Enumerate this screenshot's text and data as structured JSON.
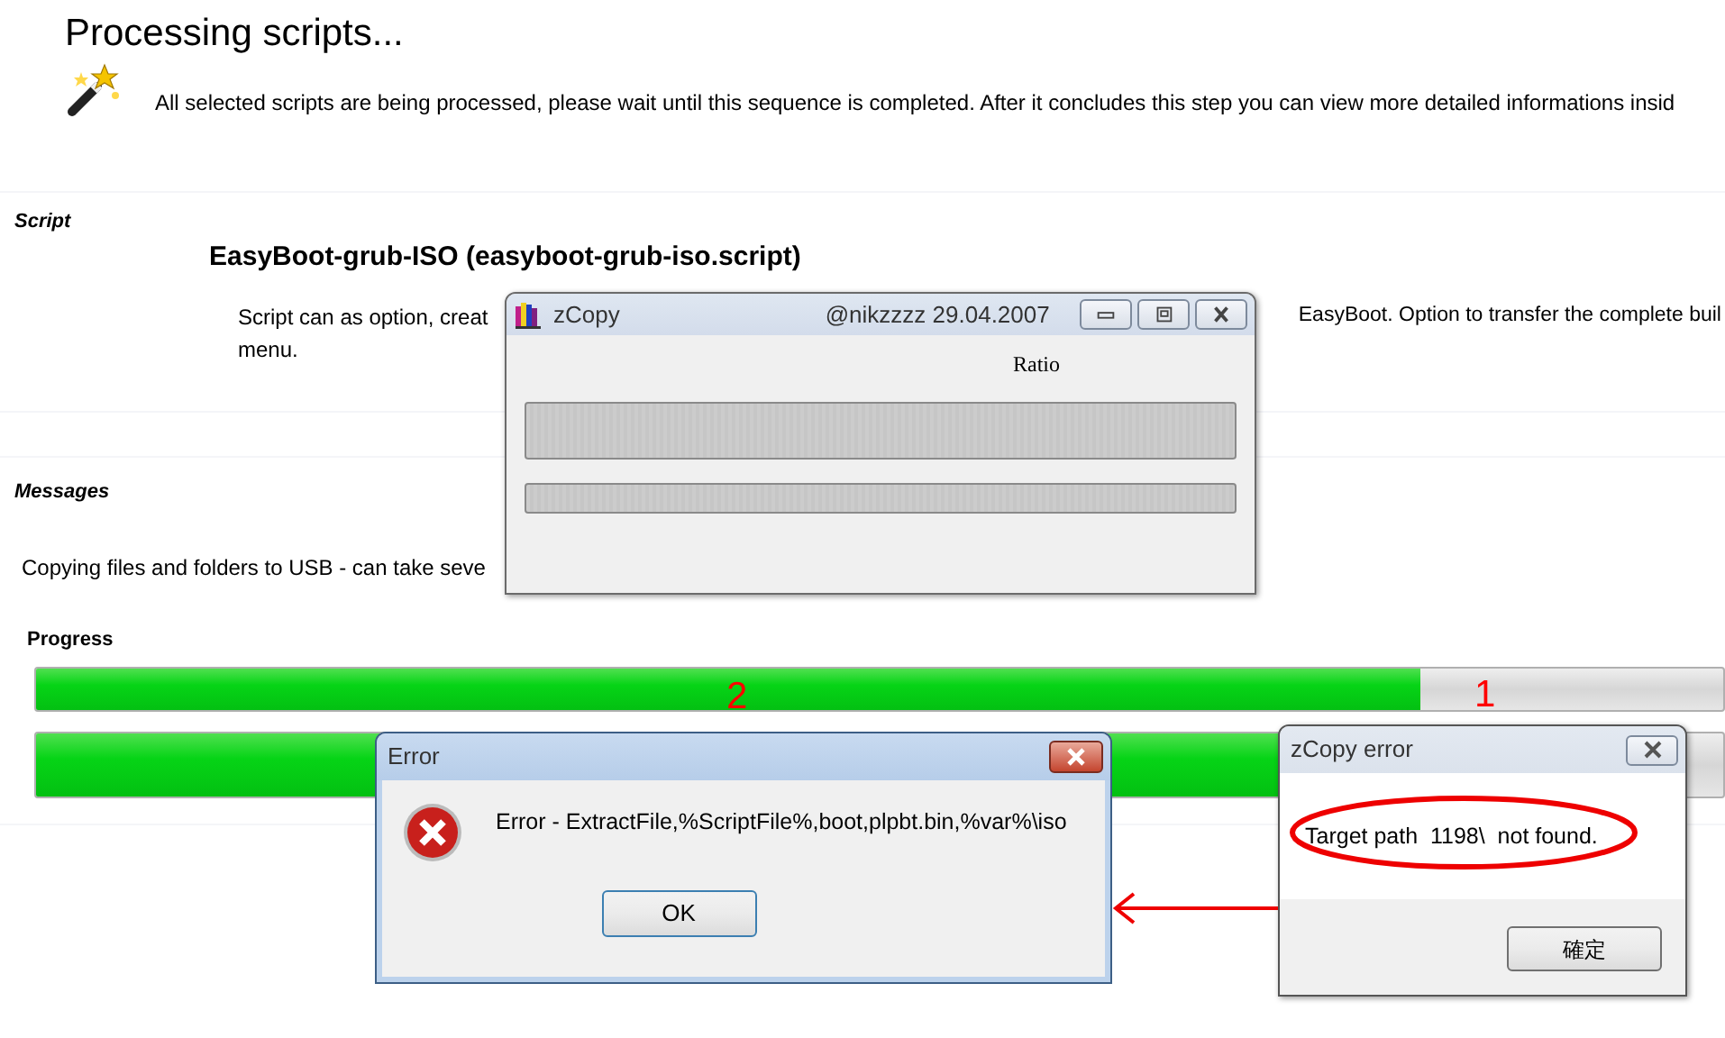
{
  "header": {
    "title": "Processing scripts...",
    "message": "All selected scripts are being processed, please wait until this sequence is completed. After it concludes this step you can view more detailed informations insid"
  },
  "script_section": {
    "label": "Script",
    "name": "EasyBoot-grub-ISO (easyboot-grub-iso.script)",
    "description_parts": [
      "Script can as option, creat",
      "EasyBoot. Option to transfer the complete buil",
      "menu."
    ]
  },
  "messages_section": {
    "label": "Messages",
    "message": "Copying files and folders to USB - can take seve"
  },
  "progress_section": {
    "label": "Progress",
    "bars": [
      {
        "level": 0.82
      },
      {
        "level": 0.78
      }
    ]
  },
  "zcopy_window": {
    "title": "zCopy",
    "subtitle": "@nikzzzz 29.04.2007",
    "ratio_label": "Ratio",
    "bars": [
      {
        "level": 0
      },
      {
        "level": 0
      }
    ]
  },
  "error_dialog": {
    "title": "Error",
    "message": "Error - ExtractFile,%ScriptFile%,boot,plpbt.bin,%var%\\iso",
    "button": "OK"
  },
  "zcopy_error_dialog": {
    "title": "zCopy error",
    "message": "Target path  1198\\  not found.",
    "button": "確定"
  },
  "annotations": [
    {
      "kind": "number",
      "text": "2"
    },
    {
      "kind": "number",
      "text": "1"
    },
    {
      "kind": "ellipse"
    },
    {
      "kind": "arrow"
    }
  ]
}
